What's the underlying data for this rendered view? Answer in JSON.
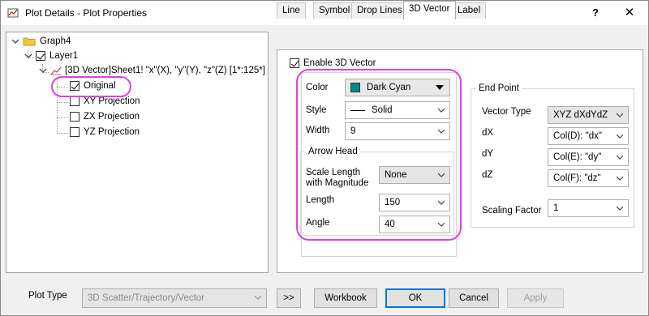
{
  "window": {
    "title": "Plot Details - Plot Properties",
    "help_label": "?",
    "close_label": "✕"
  },
  "tree": {
    "graph": "Graph4",
    "layer": "Layer1",
    "plot": "[3D Vector]Sheet1! \"x\"(X), \"y\"(Y), \"z\"(Z) [1*:125*]",
    "children": [
      "Original",
      "XY Projection",
      "ZX Projection",
      "YZ Projection"
    ]
  },
  "tabs": [
    "Line",
    "Symbol",
    "Drop Lines",
    "3D Vector",
    "Label"
  ],
  "active_tab": "3D Vector",
  "vector": {
    "enable_label": "Enable 3D Vector",
    "color_label": "Color",
    "color_value": "Dark Cyan",
    "color_hex": "#008b8b",
    "style_label": "Style",
    "style_value": "Solid",
    "width_label": "Width",
    "width_value": "9",
    "arrow_head_title": "Arrow Head",
    "scale_label_1": "Scale Length",
    "scale_label_2": "with Magnitude",
    "scale_value": "None",
    "length_label": "Length",
    "length_value": "150",
    "angle_label": "Angle",
    "angle_value": "40"
  },
  "endpoint": {
    "title": "End Point",
    "vector_type_label": "Vector Type",
    "vector_type_value": "XYZ dXdYdZ",
    "dx_label": "dX",
    "dx_value": "Col(D): \"dx\"",
    "dy_label": "dY",
    "dy_value": "Col(E): \"dy\"",
    "dz_label": "dZ",
    "dz_value": "Col(F): \"dz\"",
    "scaling_label": "Scaling Factor",
    "scaling_value": "1"
  },
  "bottom": {
    "plot_type_label": "Plot Type",
    "plot_type_value": "3D Scatter/Trajectory/Vector",
    "expand_label": ">>",
    "workbook_label": "Workbook",
    "ok_label": "OK",
    "cancel_label": "Cancel",
    "apply_label": "Apply"
  },
  "colors": {
    "highlight": "#e040e0",
    "accent": "#0078d7"
  }
}
